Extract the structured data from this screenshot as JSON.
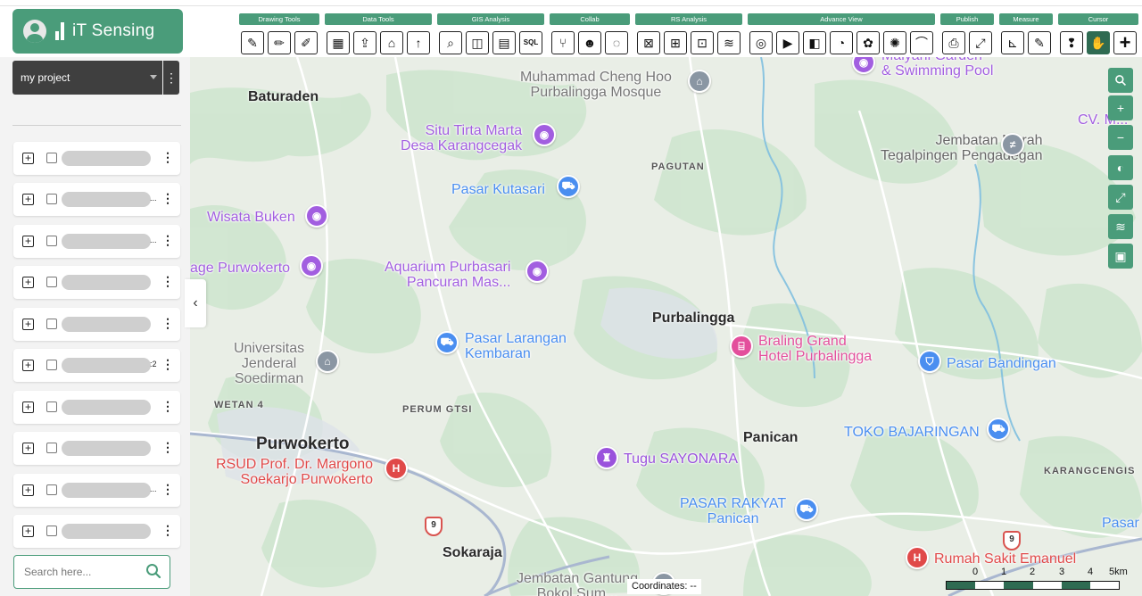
{
  "app": {
    "title": "iT Sensing"
  },
  "toolbar": {
    "groups": [
      {
        "label": "Drawing Tools",
        "tools": [
          "draw-line",
          "draw-polygon",
          "edit-feature"
        ]
      },
      {
        "label": "Data Tools",
        "tools": [
          "attribute-table",
          "upload-data",
          "import-layer",
          "export-data"
        ]
      },
      {
        "label": "GIS Analysis",
        "tools": [
          "query",
          "buffer",
          "overlay",
          "sql"
        ]
      },
      {
        "label": "Collab",
        "tools": [
          "share",
          "team",
          "comment"
        ]
      },
      {
        "label": "RS Analysis",
        "tools": [
          "classification",
          "band-math",
          "spectral-index",
          "raster-stack"
        ]
      },
      {
        "label": "Advance View",
        "tools": [
          "globe",
          "play",
          "swipe",
          "pie",
          "cluster",
          "heatmap",
          "profile"
        ]
      },
      {
        "label": "Publish",
        "tools": [
          "print",
          "publish-map"
        ]
      },
      {
        "label": "Measure",
        "tools": [
          "measure-distance",
          "measure-area"
        ]
      },
      {
        "label": "Cursor",
        "tools": [
          "info-cursor",
          "pan-cursor",
          "crosshair-cursor"
        ]
      }
    ]
  },
  "sidebar": {
    "project": {
      "selected": "my project"
    },
    "layers": [
      {
        "suffix": ""
      },
      {
        "suffix": "..."
      },
      {
        "suffix": "..."
      },
      {
        "suffix": ""
      },
      {
        "suffix": ""
      },
      {
        "suffix": ":2"
      },
      {
        "suffix": ""
      },
      {
        "suffix": ""
      },
      {
        "suffix": "..."
      },
      {
        "suffix": ""
      }
    ],
    "search": {
      "placeholder": "Search here..."
    }
  },
  "map": {
    "towns": [
      {
        "name": "Baturaden",
        "size": "large"
      },
      {
        "name": "Purbalingga",
        "size": "large"
      },
      {
        "name": "Purwokerto",
        "size": "xlarge"
      },
      {
        "name": "Panican",
        "size": "large"
      },
      {
        "name": "Sokaraja",
        "size": "large"
      }
    ],
    "areas": [
      "PAGUTAN",
      "WETAN 4",
      "PERUM GTSI",
      "KARANGCENGIS"
    ],
    "pois": [
      {
        "name": "Muhammad Cheng Hoo\nPurbalingga Mosque",
        "icon": "gray",
        "color": "#777"
      },
      {
        "name": "Situ Tirta Marta\nDesa Karangcegak",
        "icon": "purple",
        "color": "#a25ee0"
      },
      {
        "name": "Jembatan Merah\nTegalpingen Pengadegan",
        "icon": "gray",
        "color": "#666"
      },
      {
        "name": "Pasar Kutasari",
        "icon": "blue",
        "color": "#4a8ef0"
      },
      {
        "name": "Wisata Buken",
        "icon": "purple",
        "color": "#a25ee0"
      },
      {
        "name": "age Purwokerto",
        "icon": "purple",
        "color": "#a25ee0"
      },
      {
        "name": "Aquarium Purbasari\nPancuran Mas...",
        "icon": "purple",
        "color": "#a25ee0"
      },
      {
        "name": "Pasar Larangan\nKembaran",
        "icon": "blue",
        "color": "#4a8ef0"
      },
      {
        "name": "Braling Grand\nHotel Purbalingga",
        "icon": "pink",
        "color": "#e34f9c"
      },
      {
        "name": "Pasar Bandingan",
        "icon": "blue",
        "color": "#4a8ef0"
      },
      {
        "name": "Universitas\nJenderal\nSoedirman",
        "icon": "gray",
        "color": "#777"
      },
      {
        "name": "TOKO BAJARINGAN",
        "icon": "blue",
        "color": "#4a8ef0"
      },
      {
        "name": "RSUD Prof. Dr. Margono\nSoekarjo Purwokerto",
        "icon": "red",
        "color": "#e04949"
      },
      {
        "name": "Tugu SAYONARA",
        "icon": "violet",
        "color": "#9a52dc"
      },
      {
        "name": "PASAR RAKYAT\nPanican",
        "icon": "blue",
        "color": "#4a8ef0"
      },
      {
        "name": "Rumah Sakit Emanuel",
        "icon": "red",
        "color": "#e04949"
      },
      {
        "name": "Jembatan Gantung\nBokol Sum...",
        "icon": "gray",
        "color": "#777"
      },
      {
        "name": "Maiyani Garden\n& Swimming Pool",
        "icon": "purple",
        "color": "#a25ee0"
      },
      {
        "name": "CV. M...",
        "icon": "purple",
        "color": "#a25ee0"
      },
      {
        "name": "Pasar M",
        "icon": "blue",
        "color": "#4a8ef0"
      }
    ],
    "shields": [
      "9",
      "9"
    ],
    "scale": {
      "ticks": [
        "0",
        "1",
        "2",
        "3",
        "4",
        "5km"
      ]
    },
    "coordinates": "Coordinates: --"
  },
  "colors": {
    "accent": "#4a9c7a",
    "accent_dark": "#2f6b52",
    "dark_panel": "#3f3f3f"
  }
}
